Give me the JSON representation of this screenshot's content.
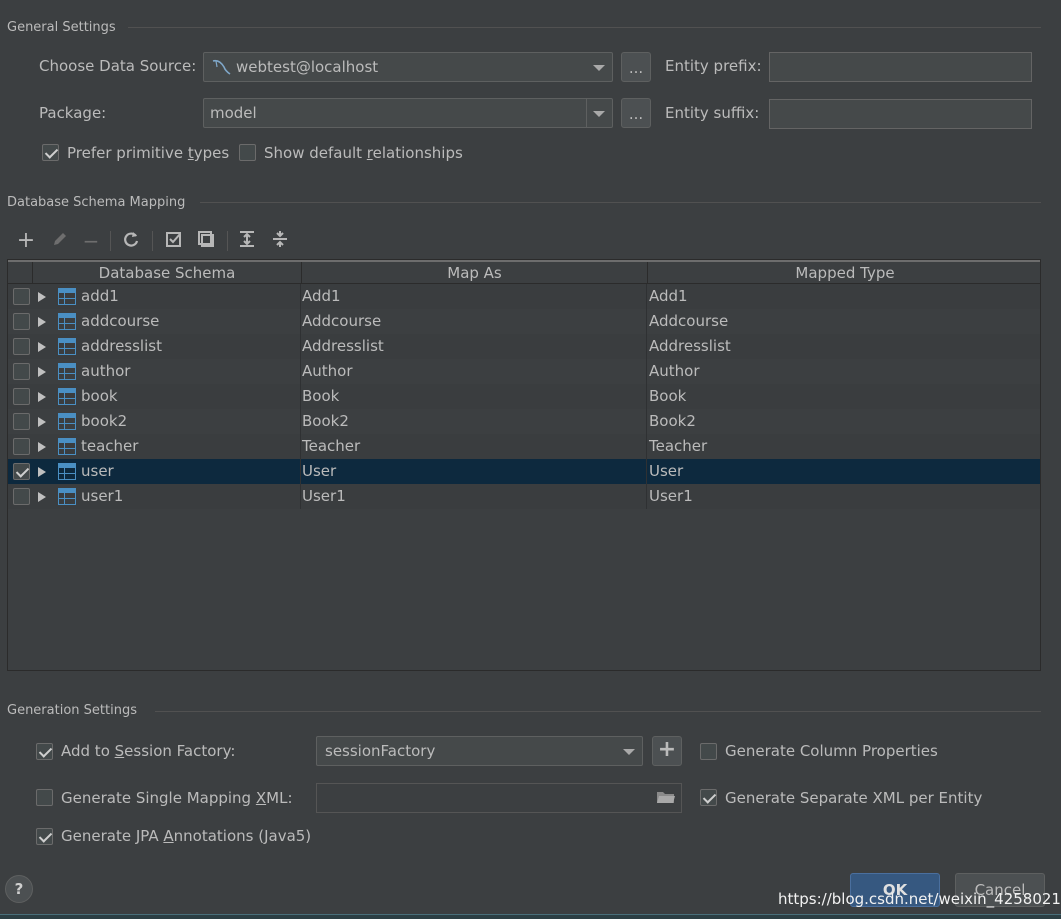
{
  "general": {
    "title": "General Settings",
    "data_source_label": "Choose Data Source:",
    "data_source_value": "webtest@localhost",
    "browse_label": "...",
    "entity_prefix_label": "Entity prefix:",
    "entity_prefix_value": "",
    "package_label": "Package:",
    "package_value": "model",
    "entity_suffix_label": "Entity suffix:",
    "entity_suffix_value": "",
    "prefer_primitive_pre": "Prefer primitive ",
    "prefer_primitive_u": "t",
    "prefer_primitive_post": "ypes",
    "prefer_primitive_checked": true,
    "show_default_pre": "Show default ",
    "show_default_u": "r",
    "show_default_post": "elationships",
    "show_default_checked": false
  },
  "schema": {
    "title": "Database Schema Mapping",
    "columns": [
      "Database Schema",
      "Map As",
      "Mapped Type"
    ],
    "rows": [
      {
        "schema": "add1",
        "map_as": "Add1",
        "mapped_type": "Add1",
        "checked": false
      },
      {
        "schema": "addcourse",
        "map_as": "Addcourse",
        "mapped_type": "Addcourse",
        "checked": false
      },
      {
        "schema": "addresslist",
        "map_as": "Addresslist",
        "mapped_type": "Addresslist",
        "checked": false
      },
      {
        "schema": "author",
        "map_as": "Author",
        "mapped_type": "Author",
        "checked": false
      },
      {
        "schema": "book",
        "map_as": "Book",
        "mapped_type": "Book",
        "checked": false
      },
      {
        "schema": "book2",
        "map_as": "Book2",
        "mapped_type": "Book2",
        "checked": false
      },
      {
        "schema": "teacher",
        "map_as": "Teacher",
        "mapped_type": "Teacher",
        "checked": false
      },
      {
        "schema": "user",
        "map_as": "User",
        "mapped_type": "User",
        "checked": true
      },
      {
        "schema": "user1",
        "map_as": "User1",
        "mapped_type": "User1",
        "checked": false
      }
    ],
    "toolbar_icons": [
      "add-icon",
      "edit-icon",
      "remove-icon",
      "refresh-icon",
      "check-all-icon",
      "uncheck-all-icon",
      "expand-all-icon",
      "collapse-all-icon"
    ]
  },
  "generation": {
    "title": "Generation Settings",
    "session_factory_pre": "Add to ",
    "session_factory_u": "S",
    "session_factory_post": "ession Factory:",
    "session_factory_checked": true,
    "session_factory_value": "sessionFactory",
    "add_label": "+",
    "gen_column_label": "Generate Column Properties",
    "gen_column_checked": false,
    "single_xml_pre": "Generate Single Mapping ",
    "single_xml_u": "X",
    "single_xml_post": "ML:",
    "single_xml_checked": false,
    "single_xml_value": "",
    "separate_xml_label": "Generate Separate XML per Entity",
    "separate_xml_checked": true,
    "jpa_pre": "Generate JPA ",
    "jpa_u": "A",
    "jpa_post": "nnotations (Java5)",
    "jpa_checked": true
  },
  "footer": {
    "help": "?",
    "ok": "OK",
    "cancel": "Cancel",
    "watermark": "https://blog.csdn.net/weixin_42580217"
  },
  "colors": {
    "background": "#3c3f41",
    "selected_row": "#0d293e",
    "ok_button": "#365880",
    "table_icon": "#4a8fc3"
  }
}
